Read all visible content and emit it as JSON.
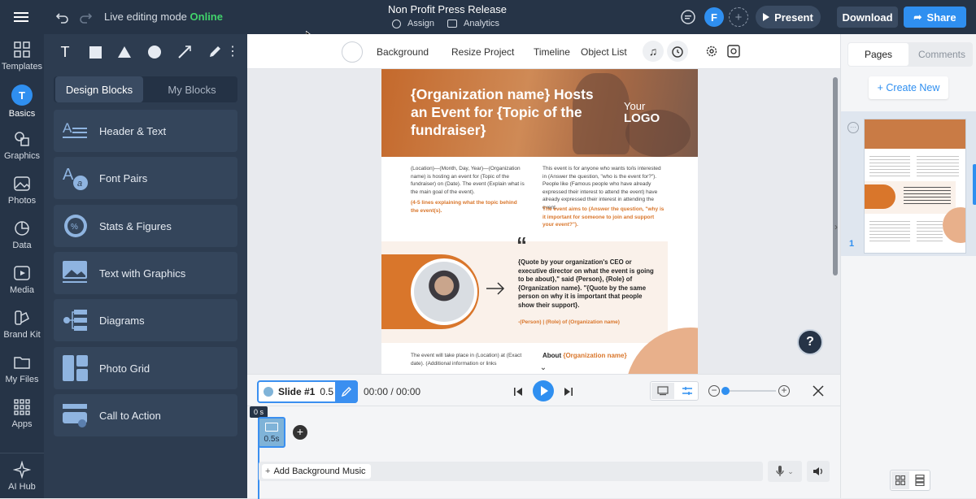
{
  "topbar": {
    "mode_text": "Live editing mode",
    "mode_status": "Online",
    "project_title": "Non Profit Press Release",
    "assign_label": "Assign",
    "analytics_label": "Analytics",
    "avatar_letter": "F",
    "present_label": "Present",
    "download_label": "Download",
    "share_label": "Share"
  },
  "rail": {
    "items": [
      {
        "label": "Templates"
      },
      {
        "label": "Basics"
      },
      {
        "label": "Graphics"
      },
      {
        "label": "Photos"
      },
      {
        "label": "Data"
      },
      {
        "label": "Media"
      },
      {
        "label": "Brand Kit"
      },
      {
        "label": "My Files"
      },
      {
        "label": "Apps"
      },
      {
        "label": "AI Hub"
      }
    ]
  },
  "panel": {
    "tabs": [
      "Design Blocks",
      "My Blocks"
    ],
    "blocks": [
      {
        "label": "Header & Text"
      },
      {
        "label": "Font Pairs"
      },
      {
        "label": "Stats & Figures"
      },
      {
        "label": "Text with Graphics"
      },
      {
        "label": "Diagrams"
      },
      {
        "label": "Photo Grid"
      },
      {
        "label": "Call to Action"
      }
    ]
  },
  "toolbar": {
    "background": "Background",
    "resize": "Resize Project",
    "timeline": "Timeline",
    "object_list": "Object List"
  },
  "doc": {
    "headline": "{Organization name} Hosts an Event for {Topic of the fundraiser}",
    "logo_top": "Your",
    "logo_bottom": "LOGO",
    "col1_text": "(Location)—(Month, Day, Year)—(Organization name) is hosting an event for (Topic of the fundraiser) on (Date). The event (Explain what is the main goal of the event).",
    "col1_highlight": "(4-5 lines explaining what the topic behind the event(s).",
    "col2_text": "This event is for anyone who wants to/is interested in (Answer the question, \"who is the event for?\"). People like (Famous people who have already expressed their interest to attend the event) have already expressed their interest in attending the event.",
    "col2_highlight": "The event aims to (Answer the question, \"why is it important for someone to join and support your event?\").",
    "quote": "{Quote by your organization's CEO or executive director on what the event is going to be about},\" said {Person}, {Role} of {Organization name}. \"{Quote by the same person on why it is important that people show their support}.",
    "quote_attrib": "-(Person) | (Role) of (Organization name)",
    "bottom_left": "The event will take place in (Location) at (Exact date). (Additional information or links",
    "bottom_right_prefix": "About",
    "bottom_right_highlight": "{Organization name}"
  },
  "right": {
    "tab_pages": "Pages",
    "tab_comments": "Comments",
    "create_new": "+ Create New",
    "page_number": "1"
  },
  "timeline": {
    "slide_label": "Slide #1",
    "slide_duration": "0.5 s",
    "time": "00:00 / 00:00",
    "marker": "0 s",
    "thumb_duration": "0.5s",
    "music_label": "Add Background Music",
    "help": "?"
  },
  "colors": {
    "accent": "#d9762b",
    "dark": "#263447",
    "online": "#41d36b",
    "share": "#2f8ff0",
    "selected": "#3a8ff0"
  }
}
